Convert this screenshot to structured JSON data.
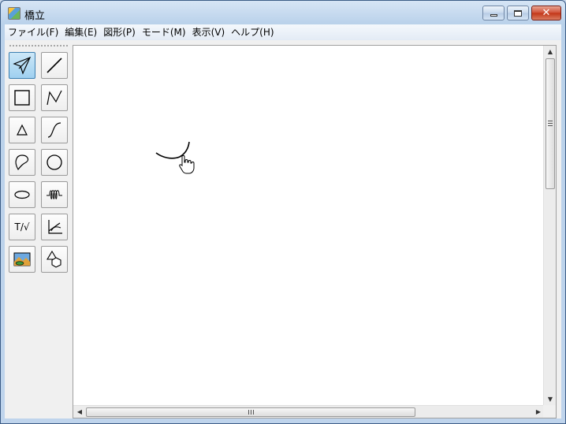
{
  "window": {
    "title": "橋立"
  },
  "menu": {
    "items": [
      {
        "label": "ファイル(F)"
      },
      {
        "label": "編集(E)"
      },
      {
        "label": "図形(P)"
      },
      {
        "label": "モード(M)"
      },
      {
        "label": "表示(V)"
      },
      {
        "label": "ヘルプ(H)"
      }
    ]
  },
  "toolbox": {
    "tools": [
      {
        "name": "select-tool",
        "icon": "arrow-select-icon",
        "active": true
      },
      {
        "name": "line-tool",
        "icon": "line-icon",
        "active": false
      },
      {
        "name": "rectangle-tool",
        "icon": "square-icon",
        "active": false
      },
      {
        "name": "polyline-tool",
        "icon": "polyline-icon",
        "active": false
      },
      {
        "name": "triangle-tool",
        "icon": "triangle-icon",
        "active": false
      },
      {
        "name": "curve-tool",
        "icon": "curve-icon",
        "active": false
      },
      {
        "name": "freeform-tool",
        "icon": "freeform-icon",
        "active": false
      },
      {
        "name": "circle-tool",
        "icon": "circle-icon",
        "active": false
      },
      {
        "name": "ellipse-tool",
        "icon": "ellipse-icon",
        "active": false
      },
      {
        "name": "spring-tool",
        "icon": "spring-icon",
        "active": false
      },
      {
        "name": "text-formula-tool",
        "icon": "text-formula-icon",
        "label": "T/√",
        "active": false
      },
      {
        "name": "graph-tool",
        "icon": "graph-axes-icon",
        "active": false
      },
      {
        "name": "image-tool",
        "icon": "image-icon",
        "active": false
      },
      {
        "name": "solid-shapes-tool",
        "icon": "solid-shapes-icon",
        "active": false
      }
    ]
  },
  "canvas": {
    "shapes": [
      {
        "type": "arc",
        "description_icon": "arc-shape"
      }
    ],
    "cursor": "hand-pointer-icon"
  }
}
